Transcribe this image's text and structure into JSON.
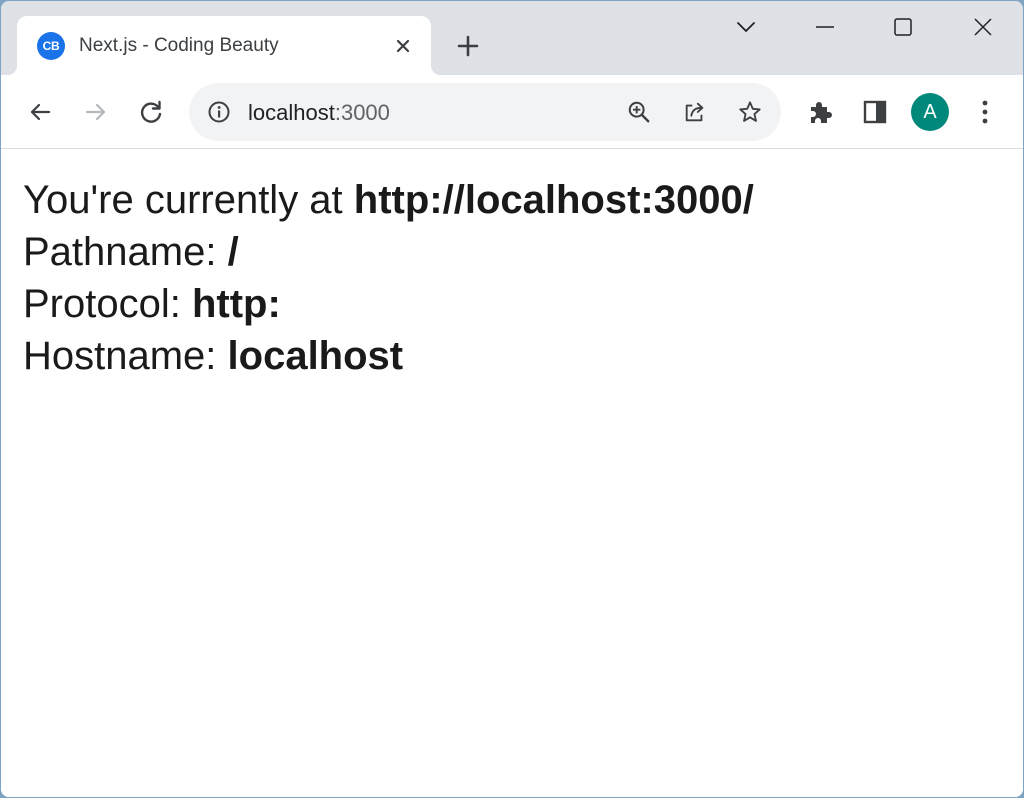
{
  "browser": {
    "tab": {
      "favicon_text": "CB",
      "favicon_color": "#1a73e8",
      "title": "Next.js - Coding Beauty"
    },
    "address_bar": {
      "host": "localhost",
      "port": ":3000"
    },
    "profile": {
      "initial": "A",
      "color": "#00897b"
    },
    "icons": {
      "tab_close": "close-icon",
      "new_tab": "plus-icon",
      "tab_search": "chevron-down-icon",
      "minimize": "minimize-icon",
      "maximize": "maximize-icon",
      "close_window": "close-icon",
      "back": "arrow-back-icon",
      "forward": "arrow-forward-icon",
      "reload": "reload-icon",
      "site_info": "info-icon",
      "zoom": "zoom-in-icon",
      "share": "share-icon",
      "bookmark": "star-icon",
      "extensions": "puzzle-icon",
      "side_panel": "side-panel-icon",
      "menu": "kebab-menu-icon"
    }
  },
  "page": {
    "lines": [
      {
        "label": "You're currently at ",
        "value": "http://localhost:3000/"
      },
      {
        "label": "Pathname: ",
        "value": "/"
      },
      {
        "label": "Protocol: ",
        "value": "http:"
      },
      {
        "label": "Hostname: ",
        "value": "localhost"
      }
    ]
  }
}
